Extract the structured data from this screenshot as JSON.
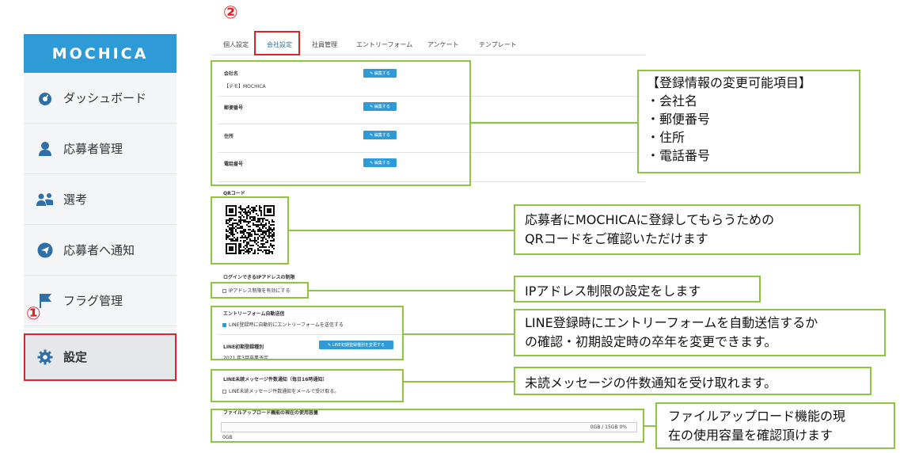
{
  "colors": {
    "brand": "#2e9ad6",
    "highlight": "#e0232b",
    "annotation": "#8cc63f"
  },
  "logo": "MOCHICA",
  "sidebar": {
    "items": [
      {
        "label": "ダッシュボード",
        "icon": "dashboard-icon"
      },
      {
        "label": "応募者管理",
        "icon": "person-icon"
      },
      {
        "label": "選考",
        "icon": "people-icon"
      },
      {
        "label": "応募者へ通知",
        "icon": "send-icon"
      },
      {
        "label": "フラグ管理",
        "icon": "flag-icon"
      },
      {
        "label": "設定",
        "icon": "gear-icon"
      }
    ]
  },
  "markers": {
    "one": "①",
    "two": "②"
  },
  "tabs": [
    "個人設定",
    "会社設定",
    "社員管理",
    "エントリーフォーム",
    "アンケート",
    "テンプレート"
  ],
  "company": {
    "name_label": "会社名",
    "name_value": "【デモ】MOCHICA",
    "postal_label": "郵便番号",
    "address_label": "住所",
    "phone_label": "電話番号",
    "edit_label": "✎ 編集する"
  },
  "qr": {
    "label": "QRコード"
  },
  "ip": {
    "label": "ログインできるIPアドレスの制限",
    "option": "IPアドレス制限を有効にする"
  },
  "entry": {
    "label": "エントリーフォーム自動送信",
    "option": "LINE登録時に自動的にエントリーフォームを送信する",
    "line_label": "LINE初期登録種別",
    "line_value": "2021 年3月卒業予定",
    "change_button": "✎ LINE初期登録種別を変更する"
  },
  "unread": {
    "label": "LINE未読メッセージ件数通知（毎日16時通知）",
    "option": "LINE未読メッセージ件数通知をメールで受け取る。"
  },
  "storage": {
    "label": "ファイルアップロード機能の現在の使用容量",
    "usage": "0GB / 15GB  0%",
    "min": "0GB",
    "fraction": 0
  },
  "callouts": {
    "registration_title": "【登録情報の変更可能項目】",
    "registration_items": [
      "・会社名",
      "・郵便番号",
      "・住所",
      "・電話番号"
    ],
    "qr_line1": "応募者にMOCHICAに登録してもらうための",
    "qr_line2": "QRコードをご確認いただけます",
    "ip": "IPアドレス制限の設定をします",
    "line_line1": "LINE登録時にエントリーフォームを自動送信するか",
    "line_line2": "の確認・初期設定時の卒年を変更できます。",
    "unread": "未読メッセージの件数通知を受け取れます。",
    "storage_line1": "ファイルアップロード機能の現",
    "storage_line2": "在の使用容量を確認頂けます"
  }
}
